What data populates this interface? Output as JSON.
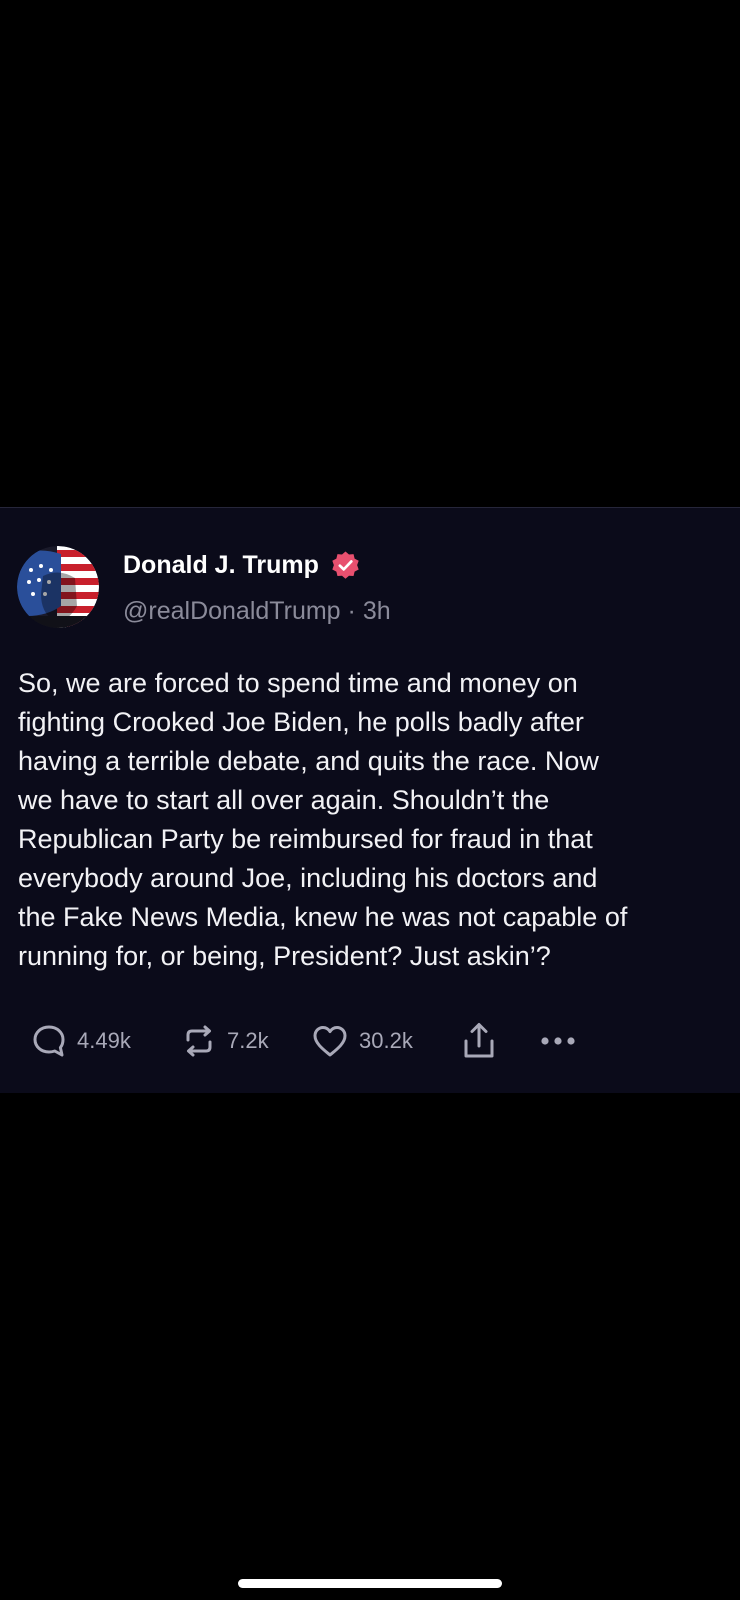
{
  "post": {
    "author_name": "Donald J. Trump",
    "handle": "@realDonaldTrump",
    "separator": " · ",
    "time": "3h",
    "text": "So, we are forced to spend time and money on\nfighting Crooked Joe Biden, he polls badly after\nhaving a terrible debate, and quits the race. Now\nwe have to start all over again. Shouldn’t the\nRepublican Party be reimbursed for fraud in that\neverybody around Joe, including his doctors and\nthe Fake News Media, knew he was not capable of\nrunning for, or being, President?  Just askin’?",
    "verified_badge_icon": "verified-badge-icon",
    "verified_badge_color": "#e8506f"
  },
  "actions": {
    "replies": "4.49k",
    "reposts": "7.2k",
    "likes": "30.2k",
    "reply_icon": "reply-icon",
    "repost_icon": "repost-icon",
    "like_icon": "heart-icon",
    "share_icon": "share-icon",
    "more_icon": "more-icon"
  },
  "colors": {
    "background": "#000000",
    "card_background": "#0b0b1a",
    "text_primary": "#ffffff",
    "text_secondary": "#8b8b9a"
  }
}
